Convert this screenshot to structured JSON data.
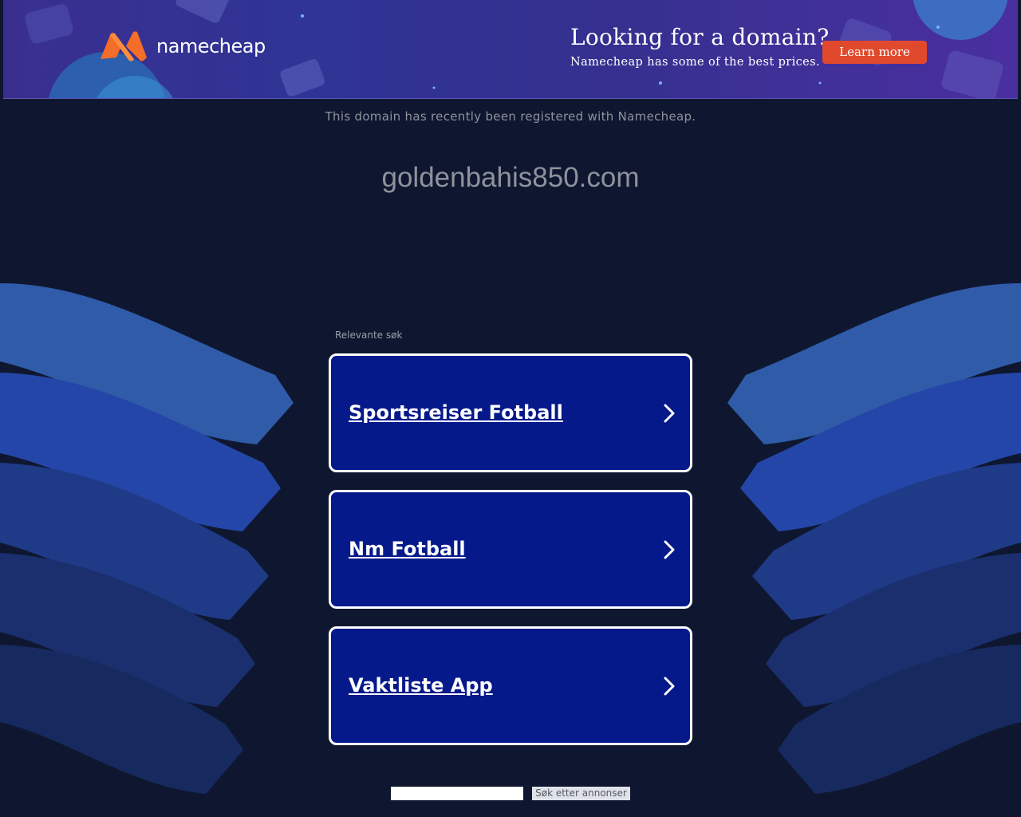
{
  "banner": {
    "brand": "namecheap",
    "title": "Looking for a domain?",
    "subtitle": "Namecheap has some of the best prices.",
    "cta_label": "Learn more",
    "cta_color": "#e1492d"
  },
  "main": {
    "registered_note": "This domain has recently been registered with Namecheap.",
    "domain": "goldenbahis850.com"
  },
  "related": {
    "label": "Relevante søk",
    "items": [
      {
        "label": "Sportsreiser Fotball"
      },
      {
        "label": "Nm Fotball"
      },
      {
        "label": "Vaktliste App"
      }
    ]
  },
  "search": {
    "value": "",
    "button_label": "Søk etter annonser"
  },
  "colors": {
    "background": "#0f1730",
    "result_box": "#06198b",
    "wave_light": "#2f5ba8",
    "wave_mid": "#2446a8",
    "wave_dark": "#1c3270"
  },
  "icons": {
    "logo": "namecheap-logo-icon",
    "chevron": "chevron-right-icon"
  }
}
